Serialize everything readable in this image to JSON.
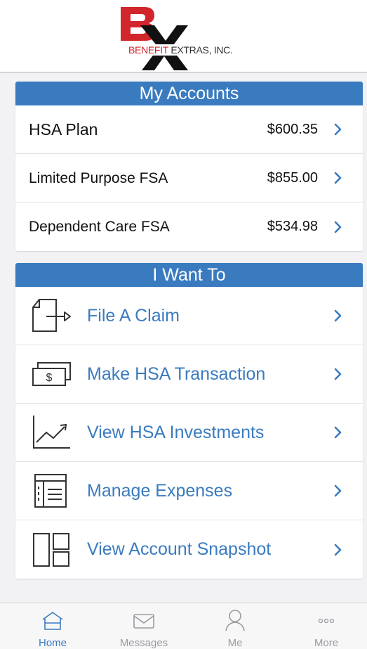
{
  "brand": {
    "letters": "BX",
    "name_red": "BENEFIT",
    "name_dark": " EXTRAS, INC."
  },
  "accounts": {
    "header": "My Accounts",
    "items": [
      {
        "name": "HSA Plan",
        "amount": "$600.35"
      },
      {
        "name": "Limited Purpose FSA",
        "amount": "$855.00"
      },
      {
        "name": "Dependent Care FSA",
        "amount": "$534.98"
      }
    ]
  },
  "want": {
    "header": "I Want To",
    "items": [
      {
        "label": "File A Claim",
        "icon": "file-claim-icon"
      },
      {
        "label": "Make HSA Transaction",
        "icon": "dollar-bill-icon"
      },
      {
        "label": "View HSA Investments",
        "icon": "line-chart-icon"
      },
      {
        "label": "Manage Expenses",
        "icon": "expense-list-icon"
      },
      {
        "label": "View Account Snapshot",
        "icon": "snapshot-layout-icon"
      }
    ]
  },
  "tabs": [
    {
      "label": "Home",
      "icon": "home-icon",
      "active": true
    },
    {
      "label": "Messages",
      "icon": "envelope-icon",
      "active": false
    },
    {
      "label": "Me",
      "icon": "person-icon",
      "active": false
    },
    {
      "label": "More",
      "icon": "more-dots-icon",
      "active": false
    }
  ],
  "colors": {
    "accent": "#3a7bbf",
    "brand_red": "#d1262b",
    "background": "#f2f2f4"
  }
}
